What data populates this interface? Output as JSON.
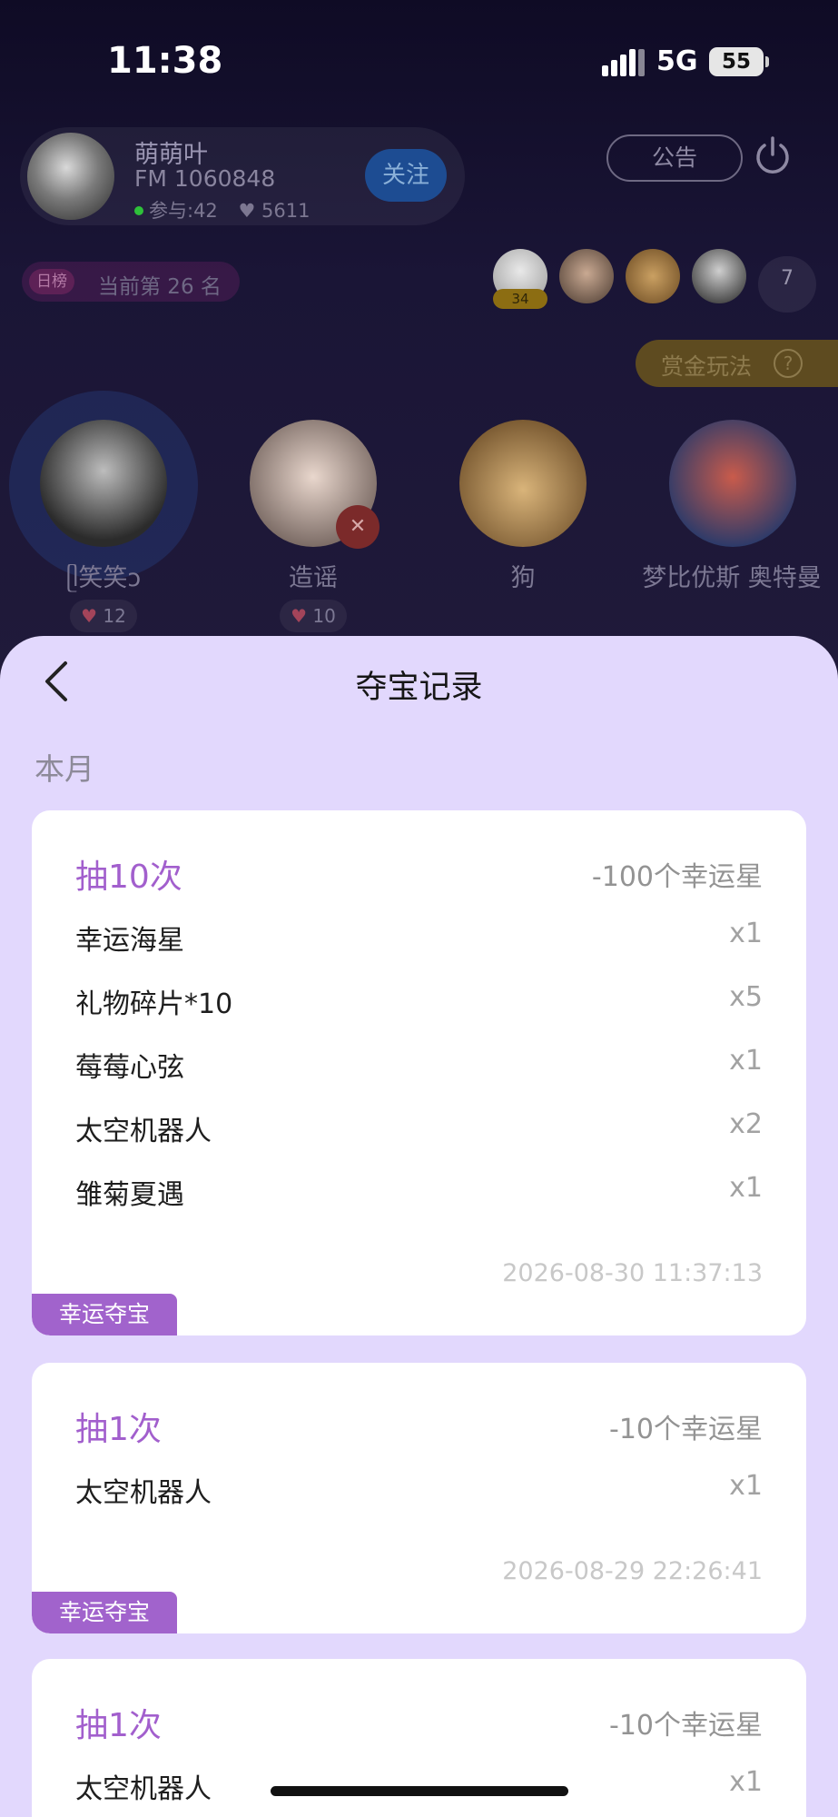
{
  "status_bar": {
    "time": "11:38",
    "network": "5G",
    "battery": "55"
  },
  "room": {
    "host": {
      "name": "萌萌叶",
      "fm": "FM 1060848",
      "participants": "参与:42",
      "likes": "5611"
    },
    "follow_label": "关注",
    "notice_label": "公告",
    "rank": {
      "tag": "日榜",
      "text": "当前第 26 名"
    },
    "audience_badge": "34",
    "audience_more": "7",
    "reward_label": "赏金玩法",
    "seats": [
      {
        "name": "ᥫ笑笑ↄ",
        "likes": "12"
      },
      {
        "name": "造谣",
        "likes": "10"
      },
      {
        "name": "狗"
      },
      {
        "name": "梦比优斯 奥特曼"
      }
    ]
  },
  "sheet": {
    "title": "夺宝记录",
    "section": "本月",
    "records": [
      {
        "draw": "抽10次",
        "cost": "-100个幸运星",
        "items": [
          {
            "name": "幸运海星",
            "qty": "x1"
          },
          {
            "name": "礼物碎片*10",
            "qty": "x5"
          },
          {
            "name": "莓莓心弦",
            "qty": "x1"
          },
          {
            "name": "太空机器人",
            "qty": "x2"
          },
          {
            "name": "雏菊夏遇",
            "qty": "x1"
          }
        ],
        "time": "2026-08-30 11:37:13",
        "tag": "幸运夺宝"
      },
      {
        "draw": "抽1次",
        "cost": "-10个幸运星",
        "items": [
          {
            "name": "太空机器人",
            "qty": "x1"
          }
        ],
        "time": "2026-08-29 22:26:41",
        "tag": "幸运夺宝"
      },
      {
        "draw": "抽1次",
        "cost": "-10个幸运星",
        "items": [
          {
            "name": "太空机器人",
            "qty": "x1"
          }
        ]
      }
    ]
  },
  "colors": {
    "accent": "#a163cc",
    "sheet_bg": "#e2d8fd",
    "draw_text": "#a25fcd"
  },
  "icons": [
    "back-chevron-icon",
    "power-icon",
    "help-icon",
    "heart-icon",
    "mic-off-icon",
    "signal-icon",
    "battery-icon"
  ]
}
